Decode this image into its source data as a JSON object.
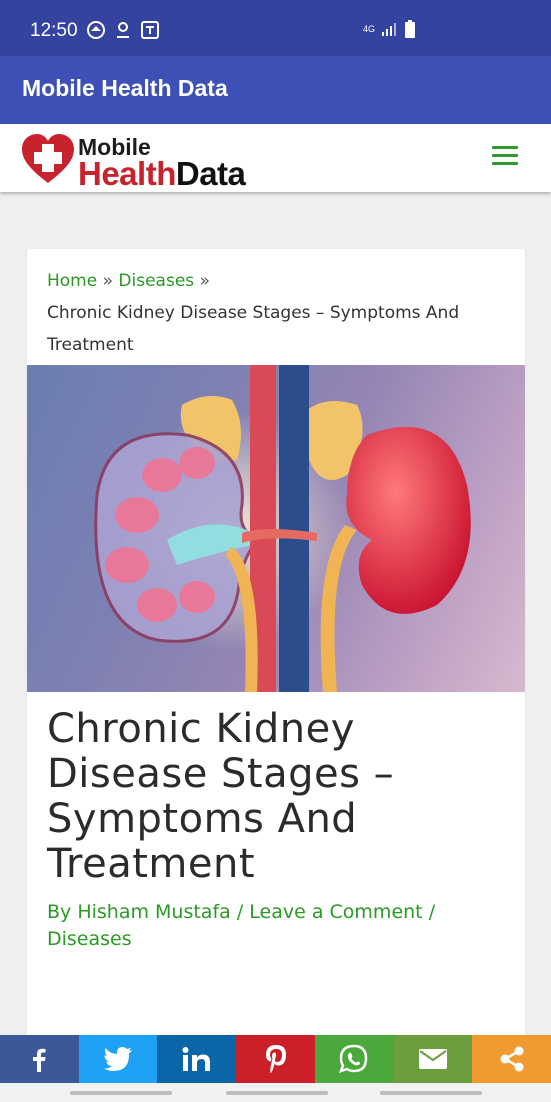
{
  "status_bar": {
    "time": "12:50",
    "network": "4G"
  },
  "app_bar": {
    "title": "Mobile Health Data"
  },
  "logo": {
    "top": "Mobile",
    "health": "Health",
    "data": "Data"
  },
  "breadcrumb": {
    "home": "Home",
    "sep": "»",
    "category": "Diseases",
    "current": "Chronic Kidney Disease Stages – Symptoms And Treatment"
  },
  "post": {
    "title": "Chronic Kidney Disease Stages – Symptoms And Treatment",
    "meta_prefix": "By",
    "author": "Hisham Mustafa",
    "slash": "/",
    "comment_link": "Leave a Comment",
    "category": "Diseases"
  },
  "share_bar": [
    {
      "name": "facebook",
      "icon": "facebook-icon",
      "color": "#3b5998"
    },
    {
      "name": "twitter",
      "icon": "twitter-icon",
      "color": "#1da1f2"
    },
    {
      "name": "linkedin",
      "icon": "linkedin-icon",
      "color": "#0a66a6"
    },
    {
      "name": "pinterest",
      "icon": "pinterest-icon",
      "color": "#cb2027"
    },
    {
      "name": "whatsapp",
      "icon": "whatsapp-icon",
      "color": "#4ba83a"
    },
    {
      "name": "email",
      "icon": "email-icon",
      "color": "#6b9e3c"
    },
    {
      "name": "share",
      "icon": "share-icon",
      "color": "#f19a2f"
    }
  ],
  "colors": {
    "status_bar": "#3443a0",
    "app_bar": "#3d50b6",
    "link_green": "#2a9a23",
    "logo_red": "#c8222c"
  }
}
